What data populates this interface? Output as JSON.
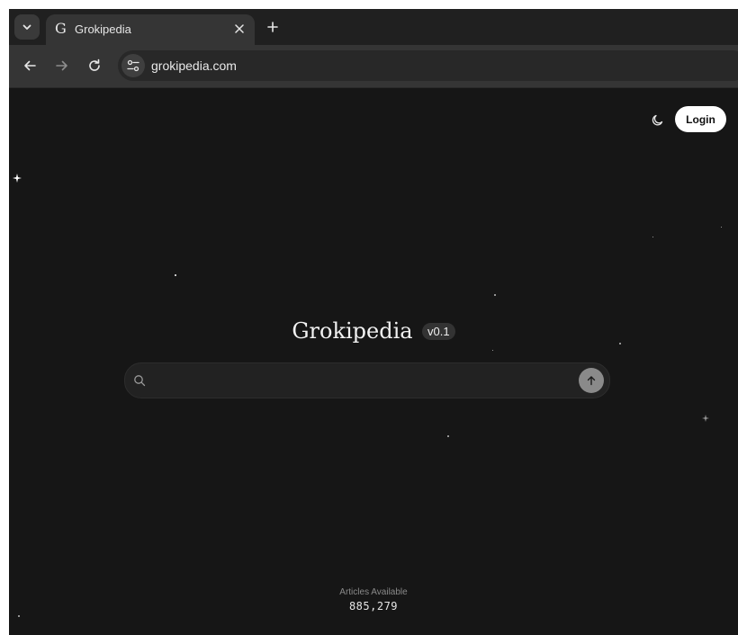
{
  "browser": {
    "tab": {
      "favicon": "G",
      "title": "Grokipedia",
      "close_icon": "close-icon"
    },
    "new_tab_icon": "plus-icon",
    "tab_list_icon": "chevron-down-icon",
    "nav": {
      "back_icon": "arrow-left-icon",
      "forward_icon": "arrow-right-icon",
      "reload_icon": "reload-icon"
    },
    "address": {
      "site_info_icon": "tune-icon",
      "url": "grokipedia.com"
    }
  },
  "page": {
    "theme_toggle_icon": "moon-icon",
    "login_label": "Login",
    "title": "Grokipedia",
    "version": "v0.1",
    "search": {
      "placeholder": "",
      "value": "",
      "search_icon": "search-icon",
      "submit_icon": "arrow-up-icon"
    },
    "stats": {
      "label": "Articles Available",
      "count": "885,279"
    }
  },
  "colors": {
    "background": "#161616",
    "browser_frame": "#202020",
    "toolbar": "#353535",
    "accent": "#ffffff"
  }
}
